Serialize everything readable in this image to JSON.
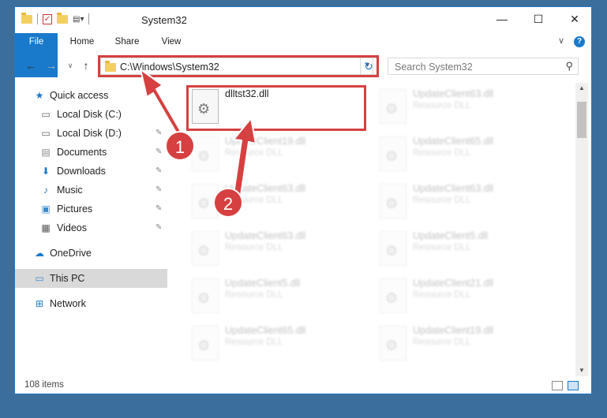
{
  "window": {
    "title": "System32",
    "minimize_icon": "—",
    "maximize_icon": "☐",
    "close_icon": "✕"
  },
  "ribbon": {
    "tabs": [
      "File",
      "Home",
      "Share",
      "View"
    ],
    "help": "?"
  },
  "nav": {
    "back": "←",
    "forward": "→",
    "recent": "∨",
    "up": "↑",
    "address": "C:\\Windows\\System32",
    "refresh": "↻",
    "search_placeholder": "Search System32",
    "search_icon": "⚲"
  },
  "sidebar": {
    "items": [
      {
        "label": "Quick access",
        "icon": "★",
        "color": "#1979ca"
      },
      {
        "label": "Local Disk (C:)",
        "icon": "▭",
        "color": "#666"
      },
      {
        "label": "Local Disk (D:)",
        "icon": "▭",
        "color": "#666"
      },
      {
        "label": "Documents",
        "icon": "▤",
        "color": "#8a8a8a"
      },
      {
        "label": "Downloads",
        "icon": "⬇",
        "color": "#1979ca"
      },
      {
        "label": "Music",
        "icon": "♪",
        "color": "#1979ca"
      },
      {
        "label": "Pictures",
        "icon": "▣",
        "color": "#3a8bd1"
      },
      {
        "label": "Videos",
        "icon": "▦",
        "color": "#555"
      },
      {
        "label": "OneDrive",
        "icon": "☁",
        "color": "#1979ca"
      },
      {
        "label": "This PC",
        "icon": "▭",
        "color": "#3a8bd1"
      },
      {
        "label": "Network",
        "icon": "⊞",
        "color": "#1979ca"
      }
    ],
    "pin_icon": "📌"
  },
  "files": [
    {
      "name": "dlltst32.dll",
      "type": ""
    },
    {
      "name": "UpdateClient63.dll",
      "type": "Resource DLL"
    },
    {
      "name": "UpdateClient19.dll",
      "type": "Resource DLL"
    },
    {
      "name": "UpdateClient65.dll",
      "type": "Resource DLL"
    },
    {
      "name": "UpdateClient63.dll",
      "type": "Resource DLL"
    },
    {
      "name": "UpdateClient63.dll",
      "type": "Resource DLL"
    },
    {
      "name": "UpdateClient63.dll",
      "type": "Resource DLL"
    },
    {
      "name": "UpdateClient5.dll",
      "type": "Resource DLL"
    },
    {
      "name": "UpdateClient5.dll",
      "type": "Resource DLL"
    },
    {
      "name": "UpdateClient21.dll",
      "type": "Resource DLL"
    },
    {
      "name": "UpdateClient65.dll",
      "type": "Resource DLL"
    },
    {
      "name": "UpdateClient19.dll",
      "type": "Resource DLL"
    }
  ],
  "status": {
    "item_count": "108 items"
  },
  "annotations": {
    "step1": "1",
    "step2": "2",
    "highlight_color": "#d64040"
  }
}
